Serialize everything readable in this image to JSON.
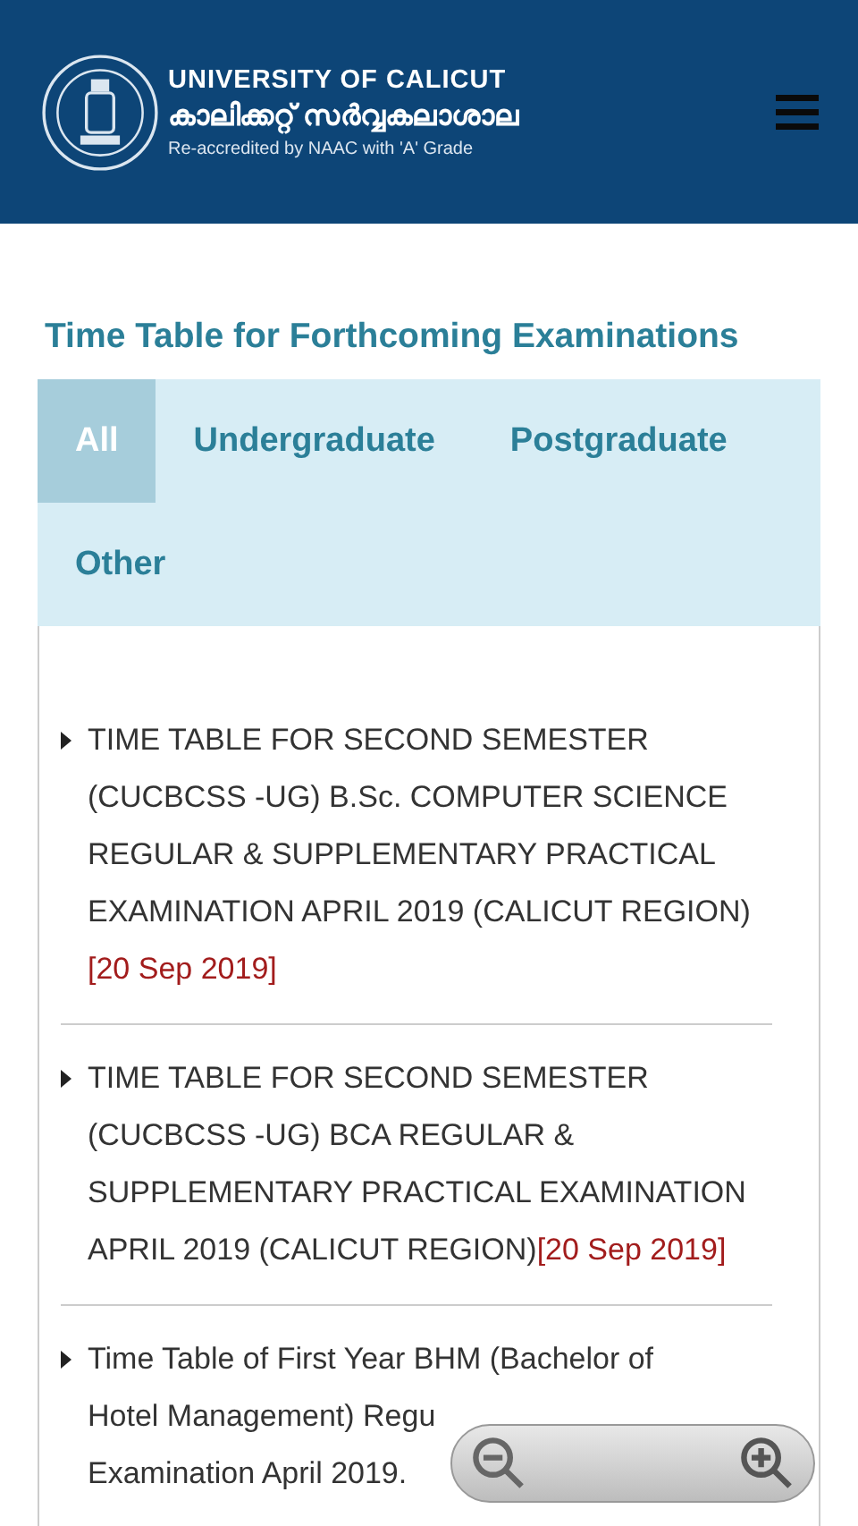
{
  "header": {
    "title": "UNIVERSITY OF CALICUT",
    "title_local": "കാലിക്കറ്റ് സർവ്വകലാശാല",
    "subtitle": "Re-accredited by NAAC with 'A' Grade"
  },
  "heading": "Time Table for Forthcoming Examinations",
  "tabs": [
    {
      "label": "All",
      "selected": true
    },
    {
      "label": "Undergraduate",
      "selected": false
    },
    {
      "label": "Postgraduate",
      "selected": false
    },
    {
      "label": "Other",
      "selected": false
    }
  ],
  "items": [
    {
      "lines": [
        "TIME TABLE FOR SECOND SEMESTER (CUCBCSS -UG) B.Sc. COMPUTER SCIENCE REGULAR & SUPPLEMENTARY PRACTICAL EXAMINATION APRIL 2019 (CALICUT REGION)"
      ],
      "date": "[20 Sep 2019]"
    },
    {
      "lines": [
        "TIME TABLE FOR SECOND SEMESTER (CUCBCSS -UG) BCA REGULAR & SUPPLEMENTARY PRACTICAL EXAMINATION APRIL 2019 (CALICUT REGION)"
      ],
      "date": "[20 Sep 2019]"
    },
    {
      "lines": [
        "Time Table of First Year BHM (Bachelor of",
        "Hotel Management) Regu",
        "Examination April 2019."
      ]
    }
  ]
}
